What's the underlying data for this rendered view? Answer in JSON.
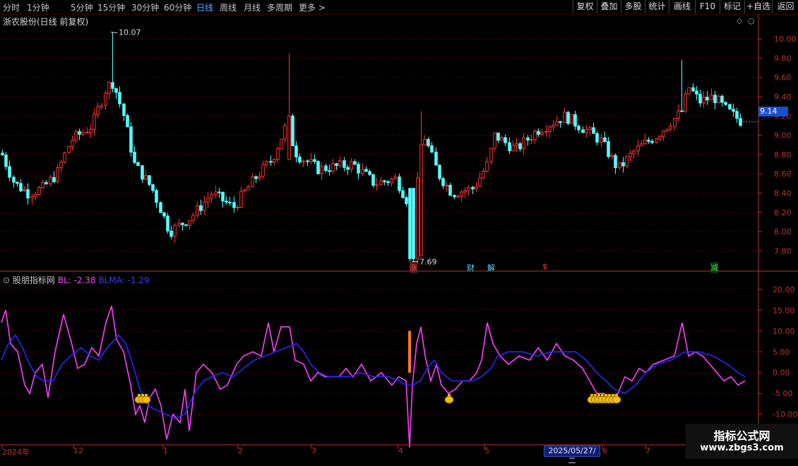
{
  "toolbar": {
    "periods": [
      "分时",
      "1分钟",
      "5分钟",
      "15分钟",
      "30分钟",
      "60分钟",
      "日线",
      "周线",
      "月线",
      "多周期",
      "更多 >"
    ],
    "active": "日线",
    "right_buttons": [
      "复权",
      "叠加",
      "多股",
      "统计",
      "画线",
      "F10",
      "标记",
      "+自选",
      "返回"
    ]
  },
  "main_chart": {
    "title": "浙农股份(日线 前复权)",
    "high_label": "10.07",
    "low_label": "7.69",
    "current_price": "9.14",
    "y_ticks": [
      "10.00",
      "9.80",
      "9.60",
      "9.40",
      "9.20",
      "9.00",
      "8.80",
      "8.60",
      "8.40",
      "8.20",
      "8.00",
      "7.80"
    ],
    "y_range": [
      7.62,
      10.14
    ],
    "event_markers": [
      "涨",
      "财",
      "解",
      "$",
      "减"
    ]
  },
  "indicator": {
    "name": "股朋指标网",
    "bl_label": "BL: -2.38",
    "blma_label": "BLMA: -1.29",
    "y_ticks": [
      "20.00",
      "15.00",
      "10.00",
      "5.00",
      "0.00",
      "-5.00",
      "-10.00"
    ],
    "y_range": [
      -17,
      22
    ]
  },
  "x_axis": {
    "labels": [
      "2024年",
      "12",
      "1",
      "2",
      "3",
      "4",
      "5",
      "6",
      "7"
    ],
    "cursor_date": "2025/05/27/二"
  },
  "watermark": {
    "line1": "指标公式网",
    "line2": "www.zbgs3.com"
  },
  "colors": {
    "up": "#ff3232",
    "down": "#54ffff",
    "bl": "#ff40ff",
    "blma": "#2828ff",
    "grid": "#5a0000",
    "axis": "#c03030"
  }
}
